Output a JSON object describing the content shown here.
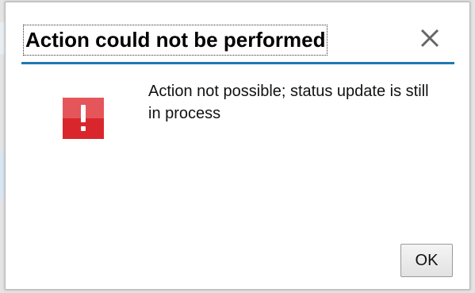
{
  "dialog": {
    "title": "Action could not be performed",
    "close_icon": "close-icon",
    "status_icon": "error-icon",
    "message": "Action not possible; status update is still in process",
    "ok_label": "OK"
  },
  "colors": {
    "accent": "#1f78b4",
    "error": "#d9262d",
    "error_light": "#e5565b"
  }
}
